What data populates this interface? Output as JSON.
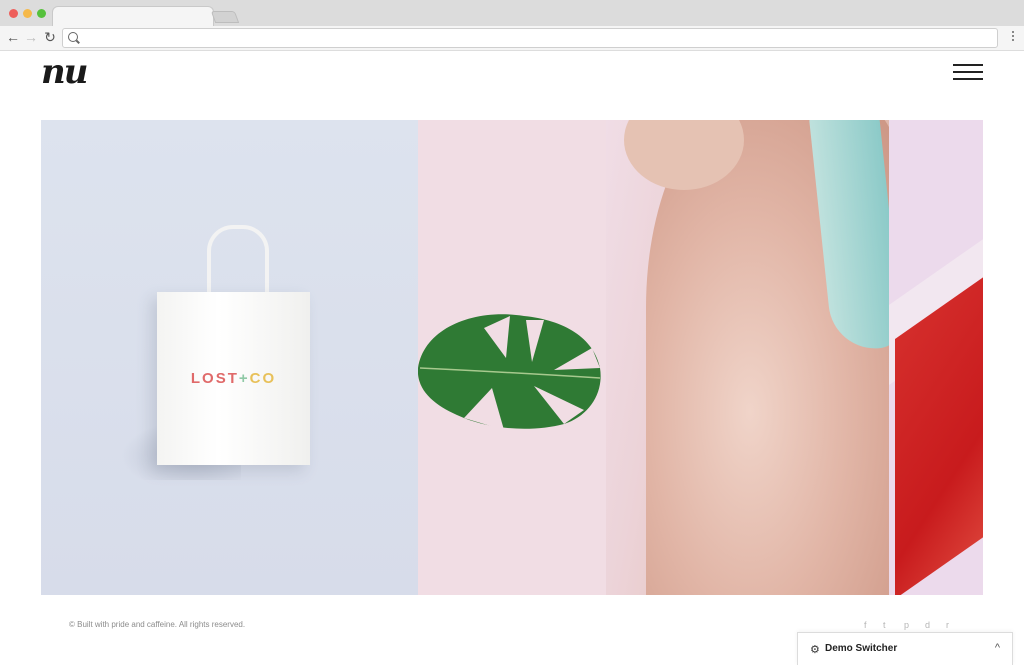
{
  "browser": {
    "nav_back": "←",
    "nav_forward": "→",
    "nav_reload": "↻",
    "url": ""
  },
  "header": {
    "logo": "nu"
  },
  "hero": {
    "bag_text": {
      "left": "LOST",
      "plus": "+",
      "right": "CO"
    }
  },
  "footer": {
    "copyright": "© Built with pride and caffeine. All rights reserved.",
    "social": [
      "f",
      "t",
      "p",
      "d",
      "r"
    ]
  },
  "demo_switcher": {
    "label": "Demo Switcher",
    "gear": "⚙",
    "chevron": "^"
  }
}
